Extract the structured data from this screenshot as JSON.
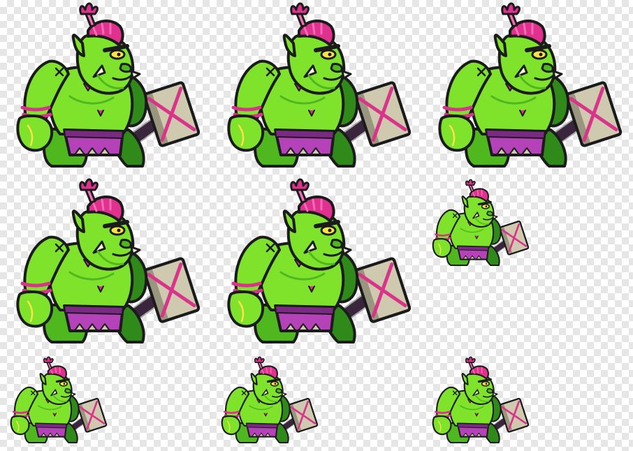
{
  "sprite_sheet": {
    "character": "ogre-with-hammer",
    "frame_count": 9,
    "colors": {
      "skin": "#7fe32c",
      "skin_shadow": "#4fb81e",
      "skin_dark": "#2f8a1a",
      "outline": "#1b1b1b",
      "hair": "#e0318f",
      "hair_light": "#f56cb4",
      "loincloth": "#b542b8",
      "loincloth_dark": "#7a2a82",
      "hammer_stone": "#cfc9b0",
      "hammer_stone_dark": "#9a957e",
      "hammer_handle": "#4a2c4e",
      "strap": "#d9348a",
      "eye": "#ffe14a",
      "tusk": "#fff5dc"
    },
    "frames": [
      {
        "name": "frame-1",
        "size": "large"
      },
      {
        "name": "frame-2",
        "size": "large"
      },
      {
        "name": "frame-3",
        "size": "large"
      },
      {
        "name": "frame-4",
        "size": "large"
      },
      {
        "name": "frame-5",
        "size": "large"
      },
      {
        "name": "frame-6",
        "size": "small"
      },
      {
        "name": "frame-7",
        "size": "small"
      },
      {
        "name": "frame-8",
        "size": "small"
      },
      {
        "name": "frame-9",
        "size": "small"
      }
    ]
  }
}
